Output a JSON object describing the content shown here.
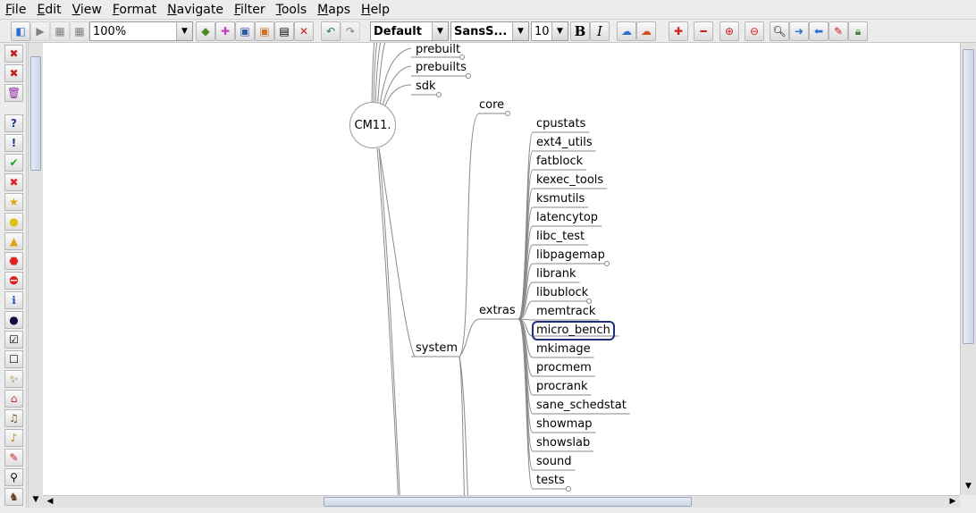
{
  "menu": [
    {
      "label": "File",
      "mnemonic": "F",
      "rest": "ile"
    },
    {
      "label": "Edit",
      "mnemonic": "E",
      "rest": "dit"
    },
    {
      "label": "View",
      "mnemonic": "V",
      "rest": "iew"
    },
    {
      "label": "Format",
      "mnemonic": "F",
      "rest": "ormat"
    },
    {
      "label": "Navigate",
      "mnemonic": "N",
      "rest": "avigate"
    },
    {
      "label": "Filter",
      "mnemonic": "F",
      "rest": "ilter"
    },
    {
      "label": "Tools",
      "mnemonic": "T",
      "rest": "ools"
    },
    {
      "label": "Maps",
      "mnemonic": "M",
      "rest": "aps"
    },
    {
      "label": "Help",
      "mnemonic": "H",
      "rest": "elp"
    }
  ],
  "toolbar": {
    "zoom_value": "100%",
    "style_value": "Default",
    "font_value": "SansS...",
    "size_value": "10",
    "bold_label": "B",
    "italic_label": "I"
  },
  "mindmap": {
    "root": "CM11.",
    "top_children": [
      "prebuilt",
      "prebuilts",
      "sdk"
    ],
    "system": "system",
    "core": "core",
    "extras": "extras",
    "extras_children": [
      "cpustats",
      "ext4_utils",
      "fatblock",
      "kexec_tools",
      "ksmutils",
      "latencytop",
      "libc_test",
      "libpagemap",
      "librank",
      "libublock",
      "memtrack",
      "micro_bench",
      "mkimage",
      "procmem",
      "procrank",
      "sane_schedstat",
      "showmap",
      "showslab",
      "sound",
      "tests"
    ],
    "selected_node": "micro_bench"
  },
  "colors": {
    "selection_border": "#1f2f7a",
    "edge": "#8a8a8a"
  }
}
